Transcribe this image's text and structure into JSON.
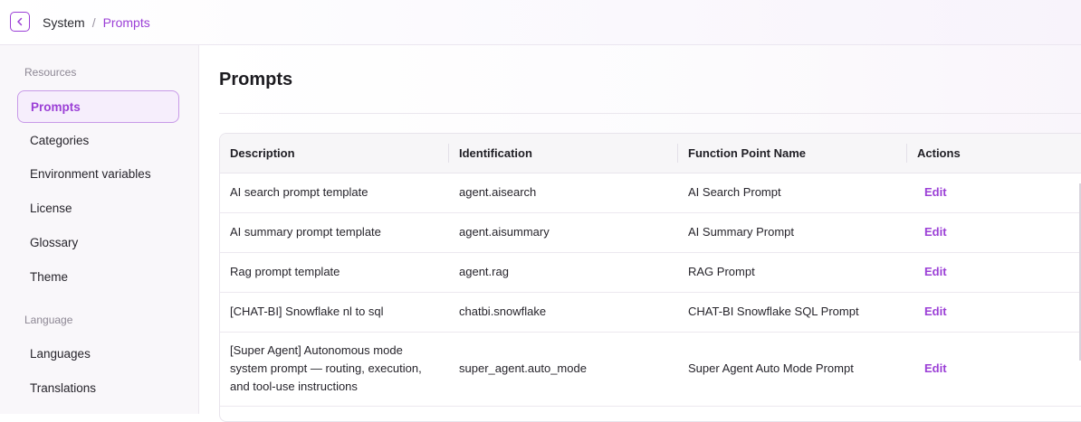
{
  "header": {
    "breadcrumb": {
      "parent": "System",
      "separator": "/",
      "current": "Prompts"
    },
    "back_icon": "chevron-left-icon"
  },
  "sidebar": {
    "sections": [
      {
        "label": "Resources",
        "items": [
          {
            "label": "Prompts",
            "active": true
          },
          {
            "label": "Categories"
          },
          {
            "label": "Environment variables"
          },
          {
            "label": "License"
          },
          {
            "label": "Glossary"
          },
          {
            "label": "Theme"
          }
        ]
      },
      {
        "label": "Language",
        "items": [
          {
            "label": "Languages"
          },
          {
            "label": "Translations"
          }
        ]
      }
    ]
  },
  "main": {
    "title": "Prompts",
    "table": {
      "columns": [
        "Description",
        "Identification",
        "Function Point Name",
        "Actions"
      ],
      "rows": [
        {
          "description": "AI search prompt template",
          "identification": "agent.aisearch",
          "function_point": "AI Search Prompt",
          "action": "Edit"
        },
        {
          "description": "AI summary prompt template",
          "identification": "agent.aisummary",
          "function_point": "AI Summary Prompt",
          "action": "Edit"
        },
        {
          "description": "Rag prompt template",
          "identification": "agent.rag",
          "function_point": "RAG Prompt",
          "action": "Edit"
        },
        {
          "description": "[CHAT-BI] Snowflake nl to sql",
          "identification": "chatbi.snowflake",
          "function_point": "CHAT-BI Snowflake SQL Prompt",
          "action": "Edit"
        },
        {
          "description": "[Super Agent] Autonomous mode system prompt — routing, execution, and tool-use instructions",
          "identification": "super_agent.auto_mode",
          "function_point": "Super Agent Auto Mode Prompt",
          "action": "Edit"
        }
      ]
    }
  },
  "colors": {
    "accent": "#9b3fd6",
    "active_bg": "#f6eefc",
    "sidebar_bg": "#f9f7fa"
  }
}
